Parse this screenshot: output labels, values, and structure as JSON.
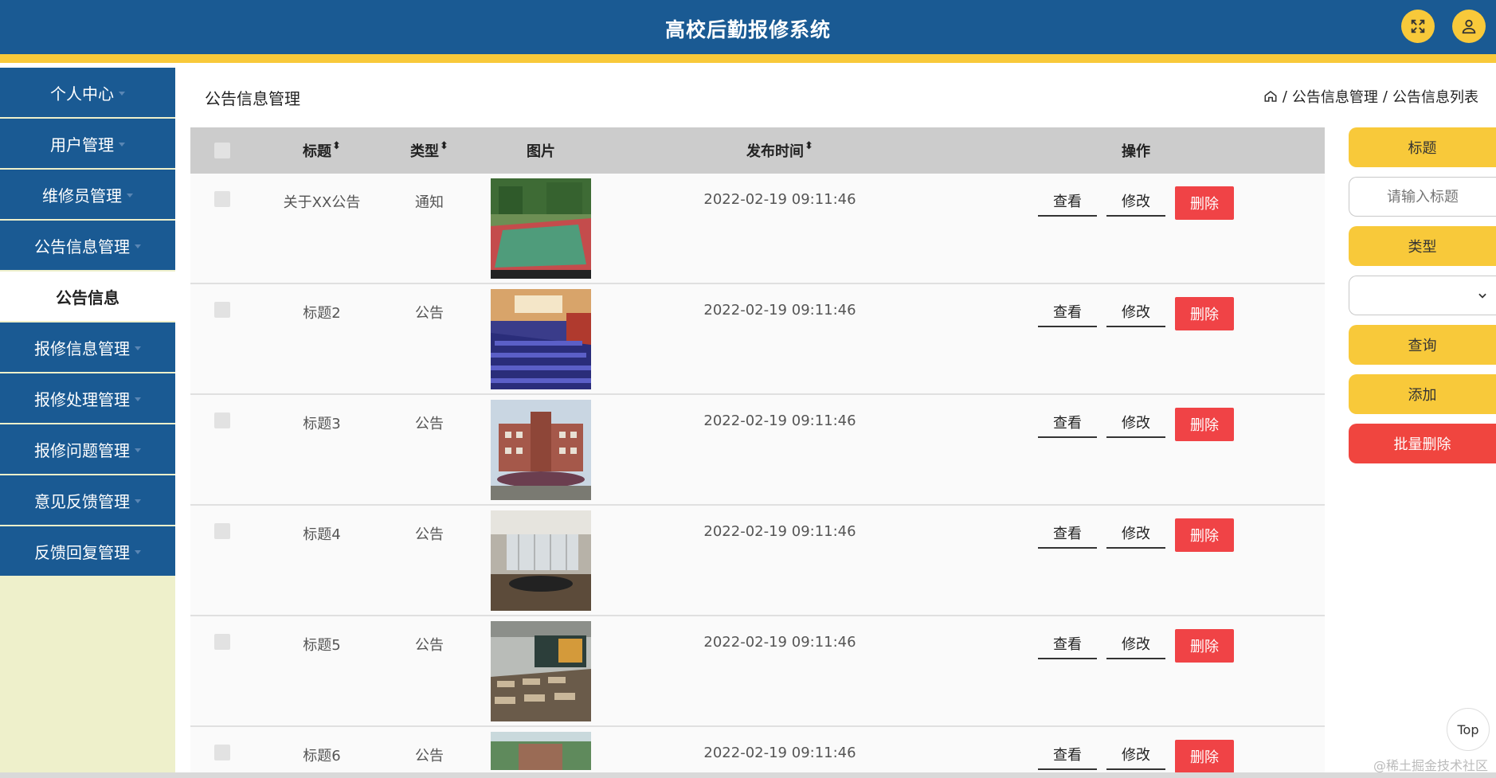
{
  "header": {
    "title": "高校后勤报修系统",
    "fullscreen_icon": "expand-icon",
    "user_icon": "user-icon",
    "accent": "#f8c93a",
    "bg": "#1a5a93"
  },
  "sidebar": {
    "items": [
      {
        "label": "个人中心",
        "caret": true
      },
      {
        "label": "用户管理",
        "caret": true
      },
      {
        "label": "维修员管理",
        "caret": true
      },
      {
        "label": "公告信息管理",
        "caret": true
      },
      {
        "label": "公告信息",
        "caret": false,
        "active": true
      },
      {
        "label": "报修信息管理",
        "caret": true
      },
      {
        "label": "报修处理管理",
        "caret": true
      },
      {
        "label": "报修问题管理",
        "caret": true
      },
      {
        "label": "意见反馈管理",
        "caret": true
      },
      {
        "label": "反馈回复管理",
        "caret": true
      }
    ]
  },
  "page": {
    "title": "公告信息管理",
    "breadcrumb": {
      "sep": "/",
      "level1": "公告信息管理",
      "level2": "公告信息列表"
    }
  },
  "table": {
    "headers": {
      "title": "标题",
      "type": "类型",
      "image": "图片",
      "time": "发布时间",
      "ops": "操作",
      "sort_icon": "⬍"
    },
    "rows": [
      {
        "title": "关于XX公告",
        "type": "通知",
        "image": "basketball-court",
        "time": "2022-02-19 09:11:46"
      },
      {
        "title": "标题2",
        "type": "公告",
        "image": "auditorium",
        "time": "2022-02-19 09:11:46"
      },
      {
        "title": "标题3",
        "type": "公告",
        "image": "campus-building",
        "time": "2022-02-19 09:11:46"
      },
      {
        "title": "标题4",
        "type": "公告",
        "image": "meeting-room",
        "time": "2022-02-19 09:11:46"
      },
      {
        "title": "标题5",
        "type": "公告",
        "image": "classroom",
        "time": "2022-02-19 09:11:46"
      },
      {
        "title": "标题6",
        "type": "公告",
        "image": "aerial-campus",
        "time": "2022-02-19 09:11:46"
      }
    ],
    "actions": {
      "view": "查看",
      "edit": "修改",
      "delete": "删除"
    }
  },
  "search": {
    "title_label": "标题",
    "title_placeholder": "请输入标题",
    "type_label": "类型",
    "type_value": "",
    "query": "查询",
    "add": "添加",
    "batch_delete": "批量删除"
  },
  "misc": {
    "top": "Top",
    "watermark": "@稀土掘金技术社区"
  }
}
